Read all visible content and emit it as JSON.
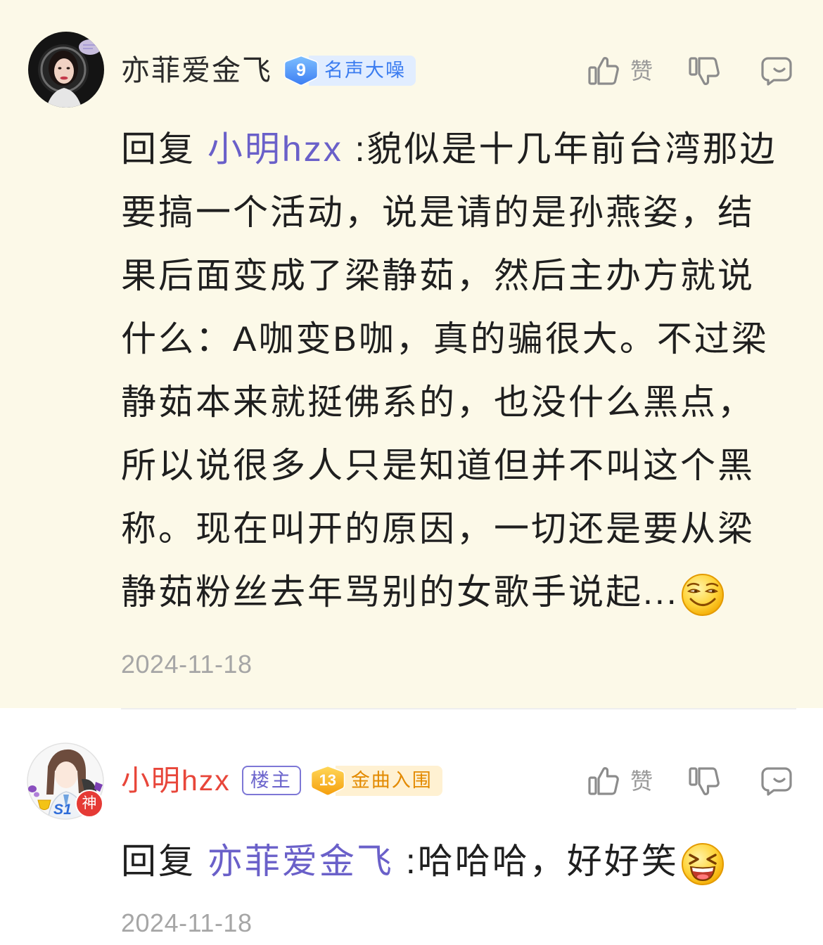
{
  "comments": [
    {
      "username": "亦菲爱金飞",
      "level": "9",
      "level_title": "名声大噪",
      "reply_prefix": "回复",
      "reply_to": "小明hzx",
      "content": ":貌似是十几年前台湾那边要搞一个活动，说是请的是孙燕姿，结果后面变成了梁静茹，然后主办方就说什么：A咖变B咖，真的骗很大。不过梁静茹本来就挺佛系的，也没什么黑点，所以说很多人只是知道但并不叫这个黑称。现在叫开的原因，一切还是要从梁静茹粉丝去年骂别的女歌手说起...",
      "emoji": "squint-smile-emoji",
      "date": "2024-11-18",
      "like_label": "赞"
    },
    {
      "username": "小明hzx",
      "avatar_badge": "神",
      "avatar_frame_text": "S1",
      "op_badge": "楼主",
      "level": "13",
      "level_title": "金曲入围",
      "reply_prefix": "回复",
      "reply_to": "亦菲爱金飞",
      "content": ":哈哈哈，好好笑",
      "emoji": "laughing-emoji",
      "date": "2024-11-18",
      "like_label": "赞"
    }
  ],
  "icons": {
    "like": "thumbs-up-icon",
    "dislike": "thumbs-down-icon",
    "reply": "comment-bubble-icon"
  },
  "colors": {
    "highlight_background": "#fcf9e8",
    "mention": "#6a60c9",
    "op_username": "#e8463a",
    "body_text": "#1f1f1f",
    "meta_text": "#a6a6a6",
    "level_blue": "#3b7ff2",
    "level_gold": "#f5a100",
    "op_badge_border": "#7d77d6"
  }
}
